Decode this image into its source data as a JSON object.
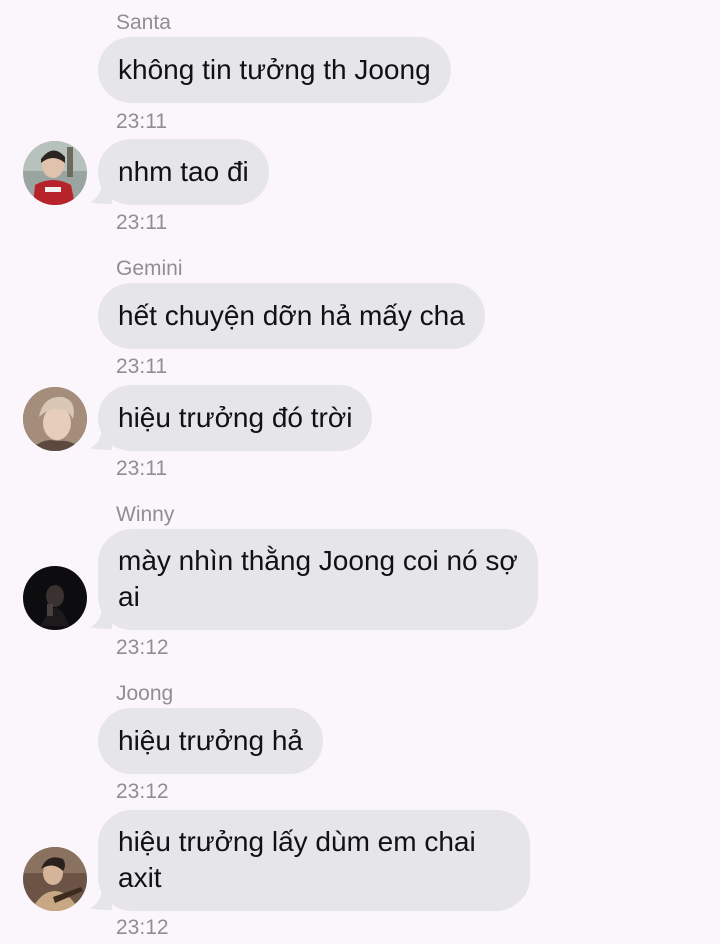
{
  "colors": {
    "background": "#fbf6fb",
    "bubble": "#e5e5ea",
    "meta_text": "#8e8e93"
  },
  "messages": [
    {
      "sender": "Santa",
      "text": "không tin tưởng th Joong",
      "time": "23:11"
    },
    {
      "sender": "",
      "text": "nhm tao đi",
      "time": "23:11",
      "avatar": "avatar-red-shirt"
    },
    {
      "sender": "Gemini",
      "text": "hết chuyện dỡn hả mấy cha",
      "time": "23:11"
    },
    {
      "sender": "",
      "text": "hiệu trưởng đó trời",
      "time": "23:11",
      "avatar": "avatar-light-hair"
    },
    {
      "sender": "Winny",
      "text": "mày nhìn thằng Joong coi nó sợ ai",
      "time": "23:12",
      "avatar": "avatar-dark"
    },
    {
      "sender": "Joong",
      "text": "hiệu trưởng hả",
      "time": "23:12"
    },
    {
      "sender": "",
      "text": "hiệu trưởng lấy dùm em chai axit",
      "time": "23:12",
      "avatar": "avatar-guitar"
    }
  ]
}
